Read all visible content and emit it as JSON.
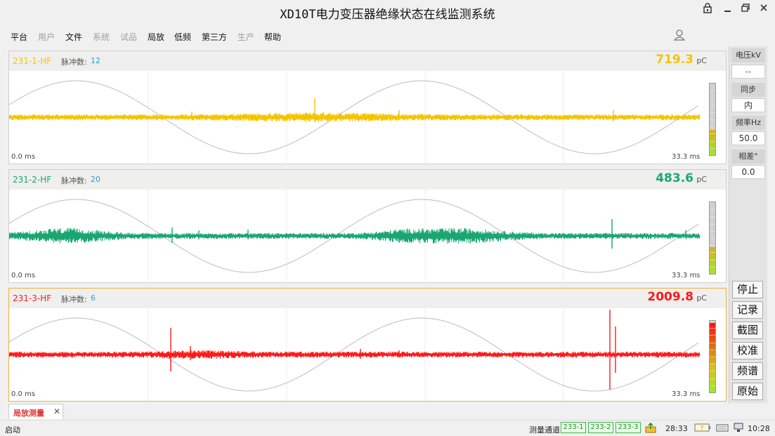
{
  "app": {
    "title": "XD10T电力变压器绝缘状态在线监测系统"
  },
  "window_controls": [
    "lock-icon",
    "minimize-icon",
    "restore-icon",
    "close-icon"
  ],
  "menu": [
    {
      "label": "平台",
      "enabled": true
    },
    {
      "label": "用户",
      "enabled": false
    },
    {
      "label": "文件",
      "enabled": true
    },
    {
      "label": "系统",
      "enabled": false
    },
    {
      "label": "试品",
      "enabled": false
    },
    {
      "label": "局放",
      "enabled": true
    },
    {
      "label": "低频",
      "enabled": true
    },
    {
      "label": "第三方",
      "enabled": true
    },
    {
      "label": "生产",
      "enabled": false
    },
    {
      "label": "帮助",
      "enabled": true
    }
  ],
  "pulse_label": "脉冲数:",
  "time_start": "0.0 ms",
  "time_end": "33.3 ms",
  "unit": "pC",
  "channels": [
    {
      "name": "231-1-HF",
      "pulse_count": "12",
      "value": "719.3",
      "color": "#f5c400",
      "meter_level": 0.35,
      "active": false
    },
    {
      "name": "231-2-HF",
      "pulse_count": "20",
      "value": "483.6",
      "color": "#1aa672",
      "meter_level": 0.37,
      "active": false
    },
    {
      "name": "231-3-HF",
      "pulse_count": "6",
      "value": "2009.8",
      "color": "#ff1a1a",
      "meter_level": 0.97,
      "active": true
    }
  ],
  "side_panel": {
    "voltage_label": "电压kV",
    "voltage_value": "--",
    "sync_label": "同步",
    "sync_value": "内",
    "freq_label": "频率Hz",
    "freq_value": "50.0",
    "phase_label": "相差°",
    "phase_value": "0.0",
    "buttons": [
      "停止",
      "记录",
      "截图",
      "校准",
      "频谱",
      "原始"
    ]
  },
  "tab": {
    "label": "局放测量"
  },
  "status": {
    "left": "启动",
    "measure_label": "测量通道",
    "channels": [
      "233-1",
      "233-2",
      "233-3"
    ],
    "time1": "28:33",
    "time2": "10:28"
  }
}
